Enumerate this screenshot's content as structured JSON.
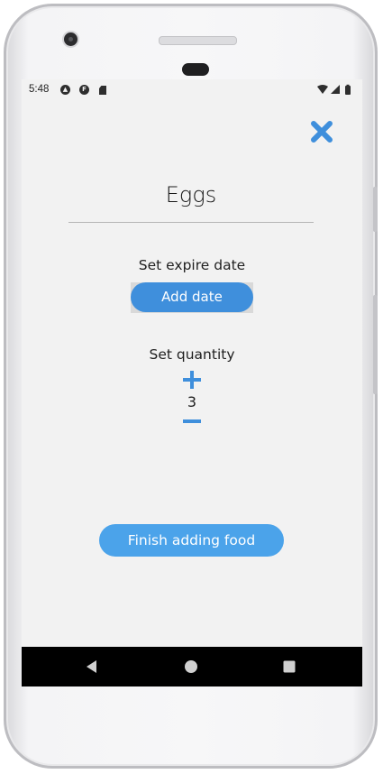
{
  "status_bar": {
    "time": "5:48",
    "icons": [
      "android-head-icon",
      "f-badge-icon",
      "sd-card-icon",
      "wifi-icon",
      "signal-icon",
      "battery-icon"
    ]
  },
  "header": {
    "close_icon": "close-x-icon"
  },
  "food": {
    "name": "Eggs"
  },
  "expire": {
    "label": "Set expire date",
    "button_label": "Add date"
  },
  "quantity": {
    "label": "Set quantity",
    "value": "3",
    "increment_icon": "plus-icon",
    "decrement_icon": "minus-icon"
  },
  "actions": {
    "finish_label": "Finish adding food"
  },
  "navigation": {
    "back_icon": "back-triangle-icon",
    "home_icon": "home-circle-icon",
    "recents_icon": "recents-square-icon"
  },
  "colors": {
    "accent": "#3f8fdc",
    "finish_button": "#4ba3ea",
    "screen_background": "#f2f2f2",
    "nav_bar": "#000000"
  }
}
